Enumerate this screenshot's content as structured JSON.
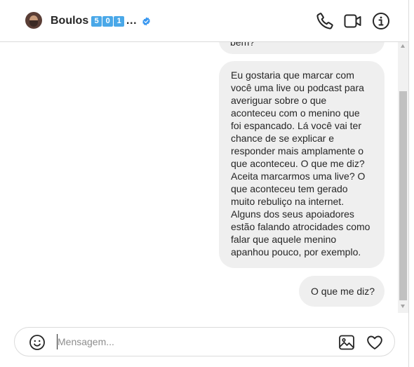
{
  "header": {
    "name": "Boulos",
    "name_digits": [
      "5",
      "0",
      "1"
    ],
    "ellipsis": "…",
    "icons": [
      "avatar",
      "verified-badge-icon",
      "phone-icon",
      "video-camera-icon",
      "info-icon"
    ],
    "verified_color": "#3897f0"
  },
  "messages": [
    {
      "sender": "self",
      "text": "bem?",
      "partially_visible": true
    },
    {
      "sender": "self",
      "text": "Eu gostaria que marcar com\nvocê uma live ou podcast para\naveriguar sobre o que\naconteceu com o menino que\nfoi espancado. Lá você vai ter\nchance de se explicar e\nresponder mais amplamente o\nque aconteceu. O que me diz?\nAceita marcarmos uma live? O\nque aconteceu tem gerado\nmuito rebuliço na internet.\nAlguns dos seus apoiadores\nestão falando atrocidades como\nfalar que aquele menino\napanhou pouco, por exemplo."
    },
    {
      "sender": "self",
      "text": "O que me diz?"
    }
  ],
  "composer": {
    "placeholder": "Mensagem...",
    "value": "",
    "icons": [
      "emoji-icon",
      "image-icon",
      "heart-icon"
    ]
  },
  "colors": {
    "bubble_bg": "#efefef",
    "text": "#262626",
    "border": "#dbdbdb",
    "placeholder": "#8e8e8e"
  }
}
